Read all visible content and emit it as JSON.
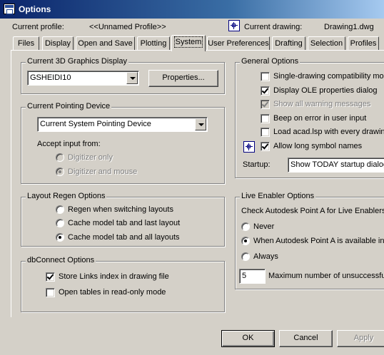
{
  "window": {
    "title": "Options"
  },
  "header": {
    "current_profile_label": "Current profile:",
    "current_profile_value": "<<Unnamed Profile>>",
    "current_drawing_label": "Current drawing:",
    "current_drawing_value": "Drawing1.dwg",
    "drawing_icon": "drawing-icon"
  },
  "tabs": [
    {
      "label": "Files"
    },
    {
      "label": "Display"
    },
    {
      "label": "Open and Save"
    },
    {
      "label": "Plotting"
    },
    {
      "label": "System",
      "active": true
    },
    {
      "label": "User Preferences"
    },
    {
      "label": "Drafting"
    },
    {
      "label": "Selection"
    },
    {
      "label": "Profiles"
    }
  ],
  "graphics_display": {
    "title": "Current 3D Graphics Display",
    "selected": "GSHEIDI10",
    "properties_button": "Properties..."
  },
  "pointing_device": {
    "title": "Current Pointing Device",
    "selected": "Current System Pointing Device",
    "accept_input_label": "Accept input from:",
    "options": [
      {
        "label": "Digitizer only",
        "selected": false,
        "enabled": false
      },
      {
        "label": "Digitizer and mouse",
        "selected": true,
        "enabled": false
      }
    ]
  },
  "layout_regen": {
    "title": "Layout Regen Options",
    "options": [
      {
        "label": "Regen when switching layouts",
        "selected": false
      },
      {
        "label": "Cache model tab and last layout",
        "selected": false
      },
      {
        "label": "Cache model tab and all layouts",
        "selected": true
      }
    ]
  },
  "dbconnect": {
    "title": "dbConnect Options",
    "options": [
      {
        "label": "Store Links index in drawing file",
        "checked": true
      },
      {
        "label": "Open tables in read-only mode",
        "checked": false
      }
    ]
  },
  "general_options": {
    "title": "General Options",
    "options": [
      {
        "label": "Single-drawing compatibility mode",
        "checked": false,
        "enabled": true
      },
      {
        "label": "Display OLE properties dialog",
        "checked": true,
        "enabled": true
      },
      {
        "label": "Show all warning messages",
        "checked": true,
        "enabled": false
      },
      {
        "label": "Beep on error in user input",
        "checked": false,
        "enabled": true
      },
      {
        "label": "Load acad.lsp with every drawing",
        "checked": false,
        "enabled": true
      },
      {
        "label": "Allow long symbol names",
        "checked": true,
        "enabled": true
      }
    ],
    "startup_label": "Startup:",
    "startup_value": "Show TODAY startup dialog"
  },
  "live_enabler": {
    "title": "Live Enabler Options",
    "prompt": "Check Autodesk Point A for Live Enablers:",
    "options": [
      {
        "label": "Never",
        "selected": false
      },
      {
        "label": "When Autodesk Point A is available in",
        "selected": true
      },
      {
        "label": "Always",
        "selected": false
      }
    ],
    "max_value": "5",
    "max_label": "Maximum number of unsuccessful"
  },
  "footer": {
    "ok": "OK",
    "cancel": "Cancel",
    "apply": "Apply"
  }
}
